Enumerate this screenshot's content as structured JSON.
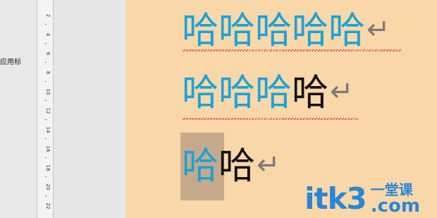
{
  "sidebar": {
    "partial_label": "应用标"
  },
  "ruler": {
    "labels": [
      "2",
      "4",
      "6",
      "8",
      "10",
      "12",
      "14",
      "16",
      "18",
      "20",
      "22"
    ]
  },
  "document": {
    "line1": {
      "text": "哈哈哈哈哈",
      "return_mark": "↵"
    },
    "line2": {
      "blue_text": "哈哈哈",
      "black_text": "哈",
      "return_mark": "↵"
    },
    "line3": {
      "selected_text": "哈",
      "black_text": "哈",
      "return_mark": "↵"
    }
  },
  "watermark": {
    "logo": "itk3",
    "cn": "一堂课",
    "com": ".com"
  },
  "colors": {
    "text_blue": "#1aa3d8",
    "page_background": "#f9d7a9",
    "selection": "#c5a98a",
    "spellcheck": "#d52a2a",
    "watermark": "#2a86d6"
  }
}
